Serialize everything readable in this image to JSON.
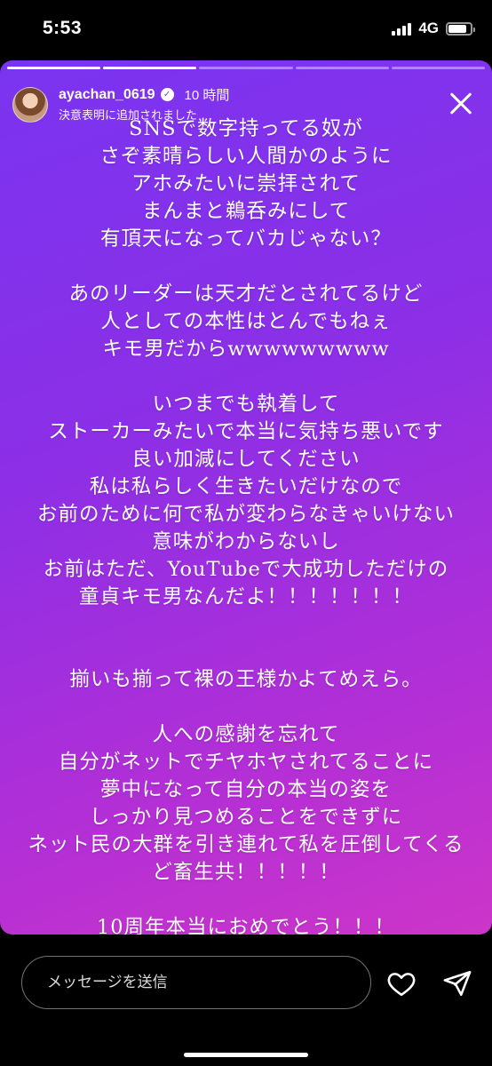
{
  "status": {
    "time": "5:53",
    "network": "4G",
    "battery_level": 0.85
  },
  "story": {
    "progress": {
      "segments": 5,
      "completed": 2
    },
    "user": {
      "username": "ayachan_0619",
      "time_ago": "10 時間",
      "subtitle": "決意表明に追加されました"
    },
    "background": {
      "from": "#7a34f0",
      "to": "#cc35c8"
    },
    "lines": [
      "SNSで数字持ってる奴が",
      "さぞ素晴らしい人間かのように",
      "アホみたいに崇拝されて",
      "まんまと鵜呑みにして",
      "有頂天になってバカじゃない？",
      "",
      "あのリーダーは天才だとされてるけど",
      "人としての本性はとんでもねぇ",
      "キモ男だからwwwwwwwww",
      "",
      "いつまでも執着して",
      "ストーカーみたいで本当に気持ち悪いです",
      "良い加減にしてください",
      "私は私らしく生きたいだけなので",
      "お前のために何で私が変わらなきゃいけない",
      "意味がわからないし",
      "お前はただ、YouTubeで大成功しただけの",
      "童貞キモ男なんだよ！！！！！！！",
      "",
      "",
      "揃いも揃って裸の王様かよてめえら。",
      "",
      "人への感謝を忘れて",
      "自分がネットでチヤホヤされてることに",
      "夢中になって自分の本当の姿を",
      "しっかり見つめることをできずに",
      "ネット民の大群を引き連れて私を圧倒してくる",
      "ど畜生共！！！！！",
      "",
      "10周年本当におめでとう！！！"
    ]
  },
  "message_bar": {
    "placeholder": "メッセージを送信"
  },
  "icons": {
    "close": "close-icon",
    "verified": "verified-badge-icon",
    "like": "heart-icon",
    "share": "send-icon"
  }
}
